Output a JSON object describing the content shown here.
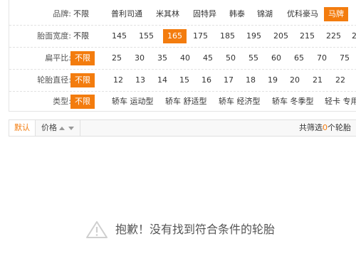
{
  "filters": {
    "brand": {
      "label": "品牌:",
      "options": [
        "不限",
        "普利司通",
        "米其林",
        "固特异",
        "韩泰",
        "锦湖",
        "优科豪马",
        "马牌"
      ],
      "selected": "马牌"
    },
    "width": {
      "label": "胎面宽度:",
      "options": [
        "不限",
        "145",
        "155",
        "165",
        "175",
        "185",
        "195",
        "205",
        "215",
        "225",
        "2"
      ],
      "selected": "165"
    },
    "ratio": {
      "label": "扁平比:",
      "options": [
        "不限",
        "25",
        "30",
        "35",
        "40",
        "45",
        "50",
        "55",
        "60",
        "65",
        "70",
        "75"
      ],
      "selected": "不限"
    },
    "diameter": {
      "label": "轮胎直径:",
      "options": [
        "不限",
        "12",
        "13",
        "14",
        "15",
        "16",
        "17",
        "18",
        "19",
        "20",
        "21",
        "22"
      ],
      "selected": "不限"
    },
    "type": {
      "label": "类型:",
      "options": [
        "不限",
        "轿车 运动型",
        "轿车 舒适型",
        "轿车 经济型",
        "轿车 冬季型",
        "轻卡 专用"
      ],
      "selected": "不限"
    }
  },
  "sortbar": {
    "default_label": "默认",
    "price_label": "价格",
    "total_prefix": "共筛选",
    "total_count": "0",
    "total_suffix": "个轮胎"
  },
  "empty_state": {
    "icon": "warning-icon",
    "message": "抱歉！没有找到符合条件的轮胎"
  },
  "colors": {
    "accent": "#f37c0e"
  }
}
